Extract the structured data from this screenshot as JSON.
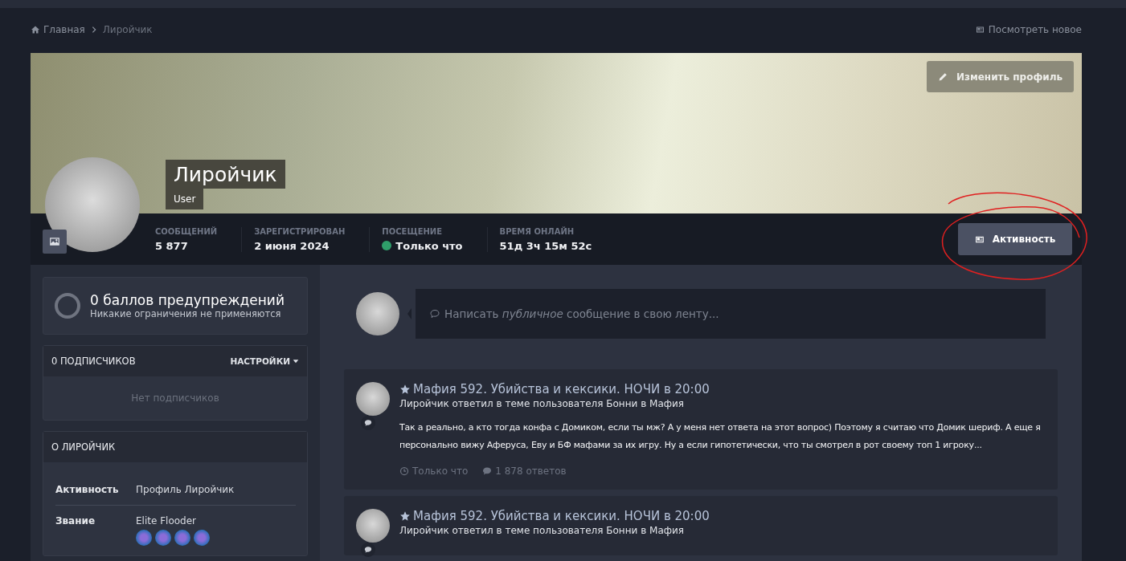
{
  "breadcrumb": {
    "items": [
      "Главная",
      "Лиройчик"
    ],
    "view_new": "Посмотреть новое"
  },
  "profile": {
    "name": "Лиройчик",
    "group": "User",
    "edit_button": "Изменить профиль",
    "activity_button": "Активность",
    "stats": [
      {
        "label": "СООБЩЕНИЙ",
        "value": "5 877",
        "online": false
      },
      {
        "label": "ЗАРЕГИСТРИРОВАН",
        "value": "2 июня 2024",
        "online": false
      },
      {
        "label": "ПОСЕЩЕНИЕ",
        "value": "Только что",
        "online": true
      },
      {
        "label": "ВРЕМЯ ОНЛАЙН",
        "value": "51д 3ч 15м 52с",
        "online": false
      }
    ]
  },
  "warnings": {
    "title": "0 баллов предупреждений",
    "subtitle": "Никакие ограничения не применяются"
  },
  "followers": {
    "title": "0 ПОДПИСЧИКОВ",
    "settings": "НАСТРОЙКИ",
    "empty": "Нет подписчиков"
  },
  "about": {
    "title": "О ЛИРОЙЧИК",
    "rows": [
      {
        "label": "Активность",
        "value": "Профиль Лиройчик",
        "kind": "text"
      },
      {
        "label": "Звание",
        "value": "Elite Flooder",
        "kind": "rank"
      }
    ]
  },
  "composer": {
    "placeholder": "Написать *публичное* сообщение в свою ленту..."
  },
  "feed": [
    {
      "title": "Мафия 592. Убийства и кексики. НОЧИ в 20:00",
      "subtitle": "Лиройчик ответил в теме пользователя Бонни в Мафия",
      "text": "Так а реально, а кто тогда конфа с Домиком, если ты мж? А у меня нет ответа на этот вопрос) Поэтому я считаю что Домик шериф. А еще я персонально вижу Аферуса, Еву и БФ мафами за их игру. Ну а если гипотетически, что ты смотрел в рот своему топ 1 игроку...",
      "time": "Только что",
      "replies": "1 878 ответов"
    },
    {
      "title": "Мафия 592. Убийства и кексики. НОЧИ в 20:00",
      "subtitle": "Лиройчик ответил в теме пользователя Бонни в Мафия"
    }
  ]
}
